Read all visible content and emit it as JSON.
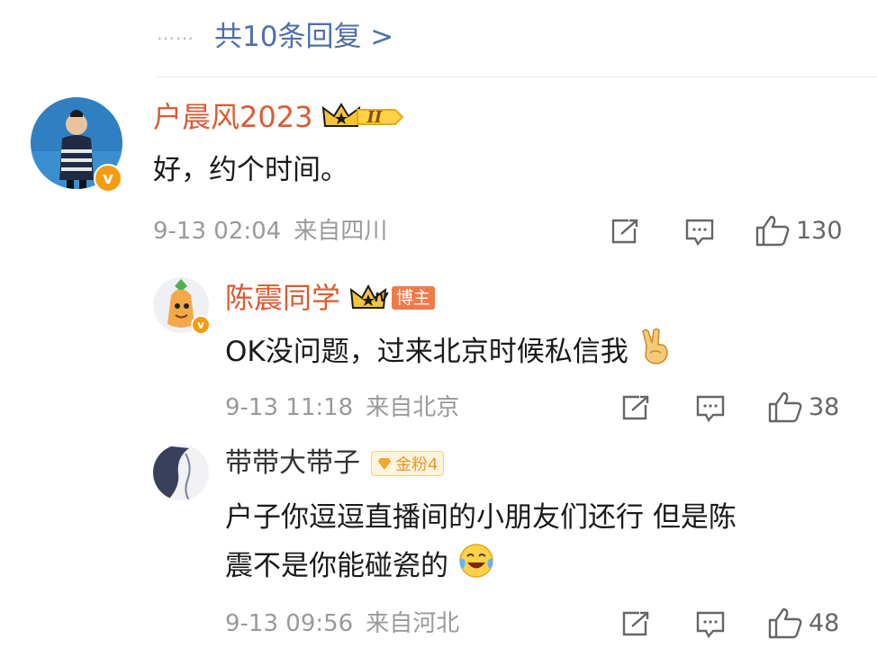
{
  "header": {
    "dots": "……",
    "more_replies": "共10条回复 >"
  },
  "comments": [
    {
      "name": "户晨风2023",
      "level_badge": "II",
      "text": "好，约个时间。",
      "date": "9-13 02:04",
      "location": "来自四川",
      "likes": "130",
      "verified_badge": "v"
    },
    {
      "name": "陈震同学",
      "level_badge": "IV",
      "role_badge": "博主",
      "text": "OK没问题，过来北京时候私信我",
      "emoji": "victory-hand",
      "date": "9-13 11:18",
      "location": "来自北京",
      "likes": "38",
      "verified_badge": "v"
    },
    {
      "name": "带带大带子",
      "fan_badge": "金粉4",
      "text_line1": "户子你逗逗直播间的小朋友们还行 但是陈",
      "text_line2": "震不是你能碰瓷的",
      "emoji": "laugh-cry",
      "date": "9-13 09:56",
      "location": "来自河北",
      "likes": "48"
    }
  ],
  "colors": {
    "link": "#4f6fa8",
    "username_highlight": "#d95b33",
    "meta_text": "#9a9a9a",
    "verified": "#f39c12"
  },
  "icons": [
    "share-icon",
    "comment-icon",
    "like-icon",
    "crown-icon"
  ]
}
